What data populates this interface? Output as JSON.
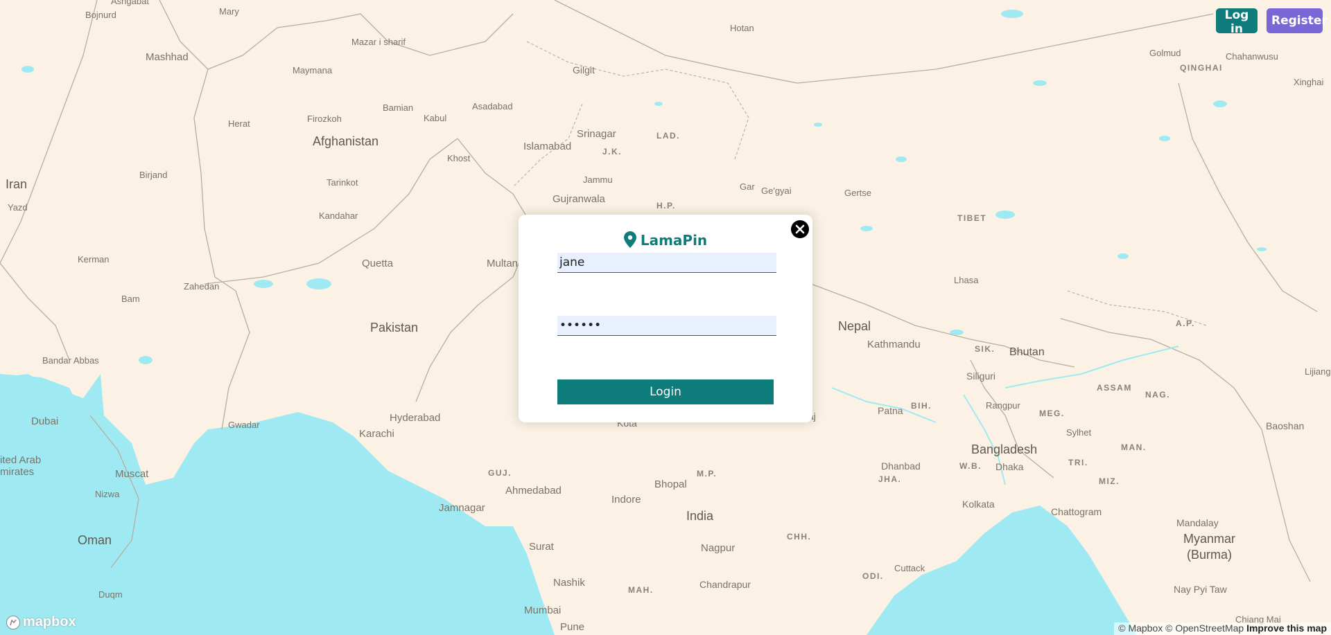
{
  "header": {
    "login_label": "Log in",
    "register_label": "Register"
  },
  "modal": {
    "brand": "LamaPin",
    "username_value": "jane",
    "password_value": "••••••",
    "submit_label": "Login"
  },
  "map": {
    "labels": {
      "ashgabat": "Ashgabat",
      "bojnurd": "Bojnurd",
      "mary": "Mary",
      "mazar": "Mazar i sharif",
      "mashhad": "Mashhad",
      "maymana": "Maymana",
      "herat": "Herat",
      "firozkoh": "Firozkoh",
      "bamian": "Bamian",
      "kabul": "Kabul",
      "asadabad": "Asadabad",
      "afghanistan": "Afghanistan",
      "khost": "Khost",
      "iran": "Iran",
      "yazd": "Yazd",
      "birjand": "Birjand",
      "tarinkot": "Tarinkot",
      "kandahar": "Kandahar",
      "quetta": "Quetta",
      "kerman": "Kerman",
      "zahedan": "Zahedan",
      "bam": "Bam",
      "pakistan": "Pakistan",
      "multan": "Multan",
      "bandar_abbas": "Bandar Abbas",
      "dubai": "Dubai",
      "gwadar": "Gwadar",
      "hyderabad": "Hyderabad",
      "karachi": "Karachi",
      "uae1": "ited Arab",
      "uae2": "mirates",
      "muscat": "Muscat",
      "nizwa": "Nizwa",
      "oman": "Oman",
      "duqm": "Duqm",
      "hotan": "Hotan",
      "gilgit": "Gilgit",
      "srinagar": "Srinagar",
      "islamabad": "Islamabad",
      "jk": "J.K.",
      "lad": "LAD.",
      "jammu": "Jammu",
      "gujranwala": "Gujranwala",
      "hp": "H.P.",
      "gar": "Gar",
      "gegyai": "Ge'gyai",
      "gertse": "Gertse",
      "tibet": "TIBET",
      "lhasa": "Lhasa",
      "golmud": "Golmud",
      "qinghai": "QINGHAI",
      "chahanwusu": "Chahanwusu",
      "xinghai": "Xinghai",
      "nepal": "Nepal",
      "kathmandu": "Kathmandu",
      "sik": "SIK.",
      "bhutan": "Bhutan",
      "ap": "A.P.",
      "siliguri": "Siliguri",
      "assam": "ASSAM",
      "nag": "NAG.",
      "lijiang": "Lijiang",
      "rangpur": "Rangpur",
      "meg": "MEG.",
      "patna": "Patna",
      "bih": "BIH.",
      "sylhet": "Sylhet",
      "baoshan": "Baoshan",
      "bangladesh": "Bangladesh",
      "man": "MAN.",
      "dhaka": "Dhaka",
      "tri": "TRI.",
      "wb": "W.B.",
      "dhanbad": "Dhanbad",
      "jha": "JHA.",
      "miz": "MIZ.",
      "kolkata": "Kolkata",
      "chattogram": "Chattogram",
      "mandalay": "Mandalay",
      "myanmar1": "Myanmar",
      "myanmar2": "(Burma)",
      "naypyitaw": "Nay Pyi Taw",
      "chiangmai": "Chiang Mai",
      "kota": "Kota",
      "guj": "GUJ.",
      "ahmedabad": "Ahmedabad",
      "mp": "M.P.",
      "bhopal": "Bhopal",
      "indore": "Indore",
      "india": "India",
      "jamnagar": "Jamnagar",
      "surat": "Surat",
      "chh": "CHH.",
      "nagpur": "Nagpur",
      "cuttack": "Cuttack",
      "odi": "ODI.",
      "nashik": "Nashik",
      "mah": "MAH.",
      "chandrapur": "Chandrapur",
      "mumbai": "Mumbai",
      "pune": "Pune",
      "aj": "aj"
    },
    "logo_text": "mapbox",
    "attribution": {
      "mapbox": "© Mapbox",
      "osm": "© OpenStreetMap",
      "improve": "Improve this map"
    }
  }
}
